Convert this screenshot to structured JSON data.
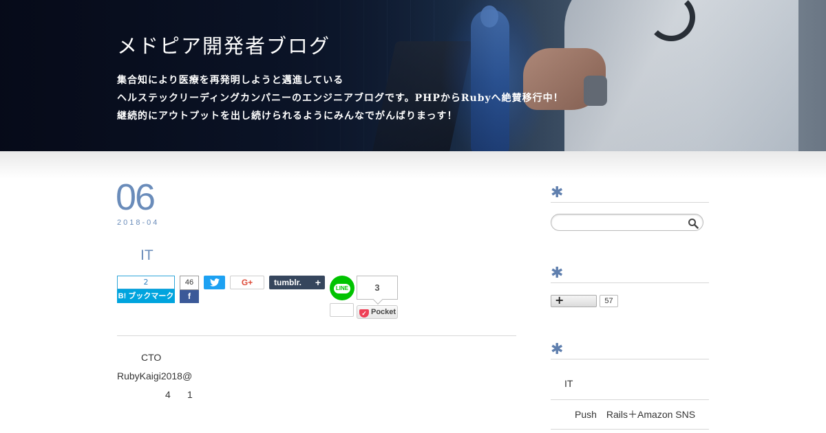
{
  "header": {
    "title": "メドピア開発者ブログ",
    "description": [
      "集合知により医療を再発明しようと邁進している",
      "ヘルステックリーディングカンパニーのエンジニアブログです。PHPからRubyへ絶賛移行中！",
      "継続的にアウトプットを出し続けられるようにみんなでがんばりまっす！"
    ]
  },
  "post": {
    "day": "06",
    "year_month": "2018-04",
    "title": "IT",
    "body": {
      "line1": "CTO",
      "line2": "RubyKaigi2018@",
      "line3a": "4",
      "line3b": "1"
    }
  },
  "share": {
    "hatena_count": "2",
    "hatena_label": "B! ブックマーク",
    "facebook_count": "46",
    "facebook_icon": "f",
    "google_plus_label": "G+",
    "tumblr_label": "tumblr.",
    "tumblr_plus": "+",
    "line_label": "LINE",
    "line_count": "3",
    "pocket_label": "Pocket",
    "pocket_icon": "✓"
  },
  "sidebar": {
    "asterisk": "✱",
    "follow_plus": "+",
    "follow_count": "57",
    "recent": [
      {
        "label": "IT"
      },
      {
        "label": "Push　Rails＋Amazon SNS"
      }
    ]
  },
  "colors": {
    "accent": "#6a8cba",
    "hatena": "#00a4de",
    "facebook": "#3b5998",
    "twitter": "#1da1f2",
    "google_plus": "#dd4b39",
    "tumblr": "#36465d",
    "line": "#00c300",
    "pocket": "#ee4056"
  },
  "icons": [
    "twitter-bird-icon",
    "search-icon",
    "facebook-icon",
    "pocket-icon",
    "line-icon",
    "plus-icon"
  ]
}
